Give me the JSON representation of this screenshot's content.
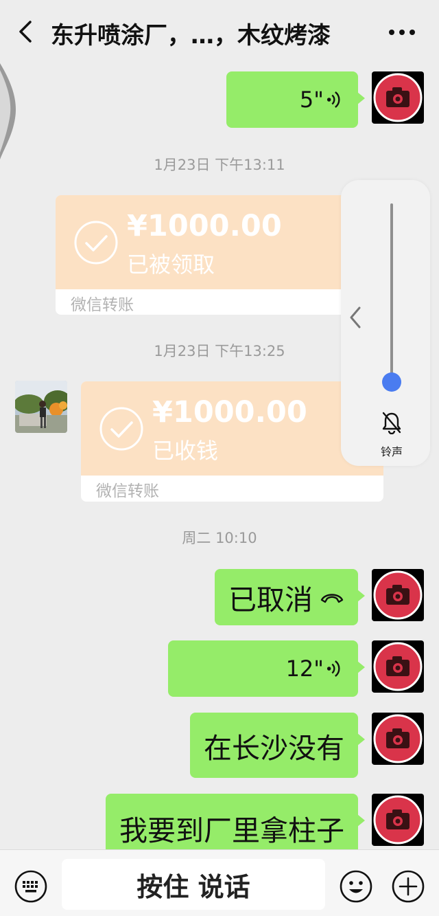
{
  "header": {
    "title": "东升喷涂厂，…，木纹烤漆"
  },
  "messages": [
    {
      "side": "me",
      "kind": "voice",
      "text": "5\""
    },
    {
      "kind": "timestamp",
      "text": "1月23日 下午13:11"
    },
    {
      "side": "other",
      "kind": "transfer",
      "amount": "¥1000.00",
      "status": "已被领取",
      "footer": "微信转账"
    },
    {
      "kind": "timestamp",
      "text": "1月23日 下午13:25"
    },
    {
      "side": "other",
      "kind": "transfer",
      "amount": "¥1000.00",
      "status": "已收钱",
      "footer": "微信转账"
    },
    {
      "kind": "timestamp",
      "text": "周二 10:10"
    },
    {
      "side": "me",
      "kind": "call",
      "text": "已取消"
    },
    {
      "side": "me",
      "kind": "voice",
      "text": "12\""
    },
    {
      "side": "me",
      "kind": "text",
      "text": "在长沙没有"
    },
    {
      "side": "me",
      "kind": "text",
      "text": "我要到厂里拿柱子"
    }
  ],
  "volume_overlay": {
    "label": "铃声",
    "level": 0.0,
    "icon": "bell-muted-icon"
  },
  "input_bar": {
    "talk_label": "按住 说话",
    "left_icon": "keyboard-icon",
    "right_icons": [
      "emoji-icon",
      "plus-icon"
    ]
  },
  "colors": {
    "background": "#ededed",
    "my_bubble": "#95ec69",
    "transfer_card": "#fce1c4",
    "volume_knob": "#4a7cf0",
    "avatar_red": "#d9344a"
  }
}
